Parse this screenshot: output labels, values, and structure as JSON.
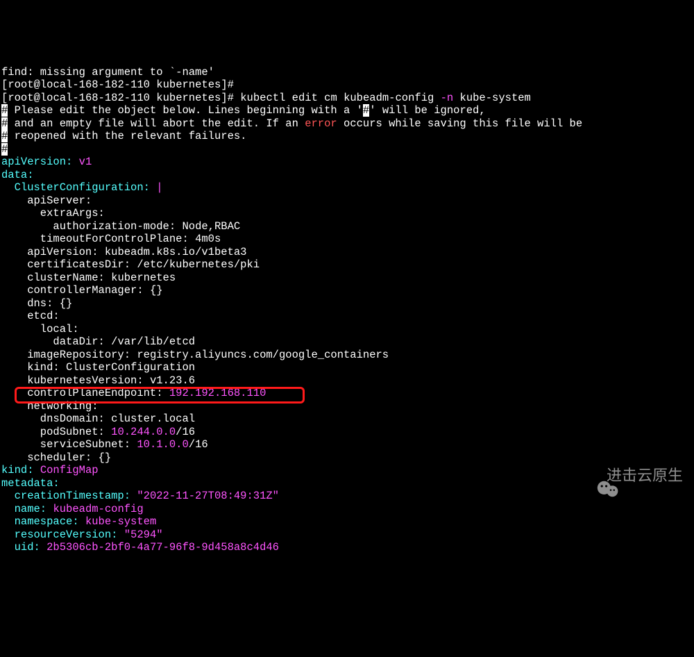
{
  "prompt": {
    "user": "root",
    "host": "local-168-182-110",
    "cwd": "kubernetes",
    "symbol": "#"
  },
  "line0_fragment": "find: missing argument to `-name'",
  "command": {
    "cmd": "kubectl edit cm kubeadm-config",
    "flag": "-n",
    "arg": "kube-system"
  },
  "editor_header": {
    "hash": "#",
    "l1a": " Please edit the object below. Lines beginning with a '",
    "l1b": "#",
    "l1c": "' will be ignored,",
    "l2a": " and an empty file will abort the edit. If an ",
    "l2_err": "error",
    "l2b": " occurs while saving this file will be",
    "l3": " reopened with the relevant failures."
  },
  "yaml": {
    "apiVersion_top": "apiVersion:",
    "apiVersion_top_val": "v1",
    "data_key": "data:",
    "cc_key": "  ClusterConfiguration:",
    "cc_pipe": "|",
    "apiServer": "    apiServer:",
    "extraArgs": "      extraArgs:",
    "authMode_k": "        authorization-mode:",
    "authMode_v": "Node,RBAC",
    "timeout_k": "      timeoutForControlPlane:",
    "timeout_v": "4m0s",
    "apiVersion_inner_k": "    apiVersion:",
    "apiVersion_inner_v": "kubeadm.k8s.io/v1beta3",
    "certDir_k": "    certificatesDir:",
    "certDir_v": "/etc/kubernetes/pki",
    "clusterName_k": "    clusterName:",
    "clusterName_v": "kubernetes",
    "controllerManager_k": "    controllerManager:",
    "controllerManager_v": "{}",
    "dns_k": "    dns:",
    "dns_v": "{}",
    "etcd": "    etcd:",
    "etcd_local": "      local:",
    "dataDir_k": "        dataDir:",
    "dataDir_v": "/var/lib/etcd",
    "imageRepo_k": "    imageRepository:",
    "imageRepo_v": "registry.aliyuncs.com/google_containers",
    "kind_inner_k": "    kind:",
    "kind_inner_v": "ClusterConfiguration",
    "k8sVersion_k": "    kubernetesVersion:",
    "k8sVersion_v": "v1.23.6",
    "cpe_k": "    controlPlaneEndpoint:",
    "cpe_v": "192.192.168.110",
    "networking": "    networking:",
    "dnsDomain_k": "      dnsDomain:",
    "dnsDomain_v": "cluster.local",
    "podSubnet_k": "      podSubnet:",
    "podSubnet_ip": "10.244.0.0",
    "podSubnet_cidr": "/16",
    "serviceSubnet_k": "      serviceSubnet:",
    "serviceSubnet_ip": "10.1.0.0",
    "serviceSubnet_cidr": "/16",
    "scheduler_k": "    scheduler:",
    "scheduler_v": "{}",
    "kind_top_k": "kind:",
    "kind_top_v": "ConfigMap",
    "metadata": "metadata:",
    "creationTs_k": "  creationTimestamp:",
    "creationTs_v": "\"2022-11-27T08:49:31Z\"",
    "name_k": "  name:",
    "name_v": "kubeadm-config",
    "namespace_k": "  namespace:",
    "namespace_v": "kube-system",
    "resourceVersion_k": "  resourceVersion:",
    "resourceVersion_v": "\"5294\"",
    "uid_k": "  uid:",
    "uid_v": "2b5306cb-2bf0-4a77-96f8-9d458a8c4d46"
  },
  "watermark": "进击云原生"
}
